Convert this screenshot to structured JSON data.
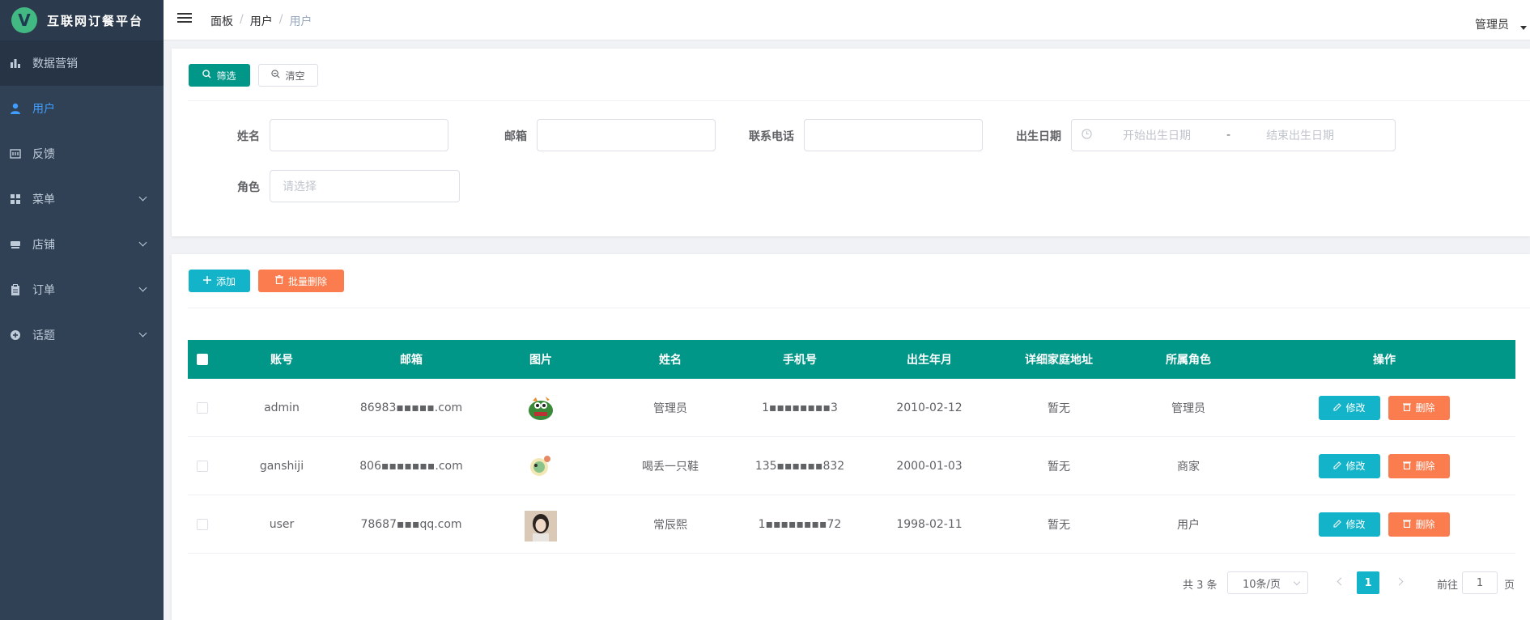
{
  "app": {
    "logo_letter": "V",
    "title": "互联网订餐平台"
  },
  "sidebar": {
    "items": [
      {
        "label": "数据营销",
        "icon": "bar-chart-icon"
      },
      {
        "label": "用户",
        "icon": "user-icon"
      },
      {
        "label": "反馈",
        "icon": "feedback-icon"
      },
      {
        "label": "菜单",
        "icon": "grid-icon"
      },
      {
        "label": "店铺",
        "icon": "shop-icon"
      },
      {
        "label": "订单",
        "icon": "clipboard-icon"
      },
      {
        "label": "话题",
        "icon": "topic-icon"
      }
    ]
  },
  "header": {
    "breadcrumb": [
      "面板",
      "用户",
      "用户"
    ],
    "separator": "/",
    "user": "管理员"
  },
  "filter": {
    "filter_button": "筛选",
    "clear_button": "清空",
    "name_label": "姓名",
    "email_label": "邮箱",
    "phone_label": "联系电话",
    "birth_label": "出生日期",
    "birth_start_placeholder": "开始出生日期",
    "birth_range_sep": "-",
    "birth_end_placeholder": "结束出生日期",
    "role_label": "角色",
    "role_placeholder": "请选择"
  },
  "toolbar": {
    "add_button": "添加",
    "batch_delete_button": "批量删除"
  },
  "table": {
    "headers": [
      "账号",
      "邮箱",
      "图片",
      "姓名",
      "手机号",
      "出生年月",
      "详细家庭地址",
      "所属角色",
      "操作"
    ],
    "rows": [
      {
        "account": "admin",
        "email": "86983▪▪▪▪▪.com",
        "name": "管理员",
        "phone": "1▪▪▪▪▪▪▪▪3",
        "birth": "2010-02-12",
        "address": "暂无",
        "role": "管理员"
      },
      {
        "account": "ganshiji",
        "email": "806▪▪▪▪▪▪▪.com",
        "name": "喝丢一只鞋",
        "phone": "135▪▪▪▪▪▪832",
        "birth": "2000-01-03",
        "address": "暂无",
        "role": "商家"
      },
      {
        "account": "user",
        "email": "78687▪▪▪qq.com",
        "name": "常辰熙",
        "phone": "1▪▪▪▪▪▪▪▪72",
        "birth": "1998-02-11",
        "address": "暂无",
        "role": "用户"
      }
    ],
    "edit_button": "修改",
    "delete_button": "删除"
  },
  "pagination": {
    "total_text": "共 3 条",
    "page_size": "10条/页",
    "current_page": "1",
    "goto_label": "前往",
    "goto_value": "1",
    "page_suffix": "页"
  },
  "colors": {
    "primary": "#009688",
    "cyan": "#13b4c9",
    "orange": "#fb7c4e",
    "sidebar": "#304156",
    "active": "#409eff"
  }
}
